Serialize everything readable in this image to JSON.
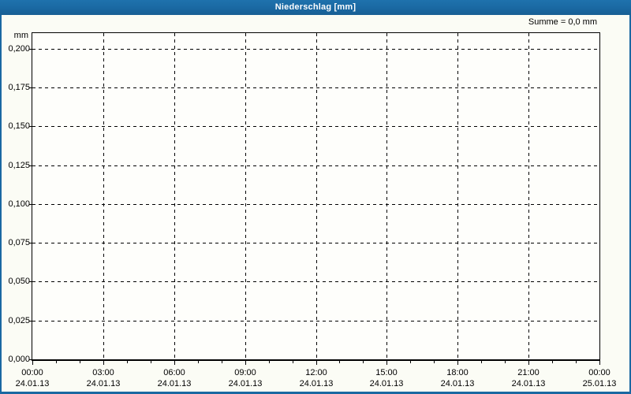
{
  "window": {
    "title": "Niederschlag [mm]"
  },
  "header": {
    "summary": "Summe = 0,0 mm"
  },
  "chart_data": {
    "type": "bar",
    "title": "Niederschlag [mm]",
    "ylabel": "mm",
    "xlabel": "",
    "ylim": [
      0,
      0.21
    ],
    "xlim_hours": [
      0,
      24
    ],
    "grid": "dashed",
    "legend_position": "none",
    "annotation": "Summe = 0,0 mm",
    "series": [
      {
        "name": "Niederschlag",
        "values": []
      }
    ],
    "y_ticks": [
      {
        "value": 0.0,
        "label": "0,000"
      },
      {
        "value": 0.025,
        "label": "0,025"
      },
      {
        "value": 0.05,
        "label": "0,050"
      },
      {
        "value": 0.075,
        "label": "0,075"
      },
      {
        "value": 0.1,
        "label": "0,100"
      },
      {
        "value": 0.125,
        "label": "0,125"
      },
      {
        "value": 0.15,
        "label": "0,150"
      },
      {
        "value": 0.175,
        "label": "0,175"
      },
      {
        "value": 0.2,
        "label": "0,200"
      }
    ],
    "x_ticks": [
      {
        "hour": 0,
        "time": "00:00",
        "date": "24.01.13"
      },
      {
        "hour": 3,
        "time": "03:00",
        "date": "24.01.13"
      },
      {
        "hour": 6,
        "time": "06:00",
        "date": "24.01.13"
      },
      {
        "hour": 9,
        "time": "09:00",
        "date": "24.01.13"
      },
      {
        "hour": 12,
        "time": "12:00",
        "date": "24.01.13"
      },
      {
        "hour": 15,
        "time": "15:00",
        "date": "24.01.13"
      },
      {
        "hour": 18,
        "time": "18:00",
        "date": "24.01.13"
      },
      {
        "hour": 21,
        "time": "21:00",
        "date": "24.01.13"
      },
      {
        "hour": 24,
        "time": "00:00",
        "date": "25.01.13"
      }
    ],
    "x_minor_tick_interval_hours": 1
  },
  "colors": {
    "accent_blue": "#1a68a2",
    "grid_line": "#000000",
    "plot_background": "#fefefb",
    "page_background": "#fbfcf5",
    "title_text": "#ffffff"
  }
}
